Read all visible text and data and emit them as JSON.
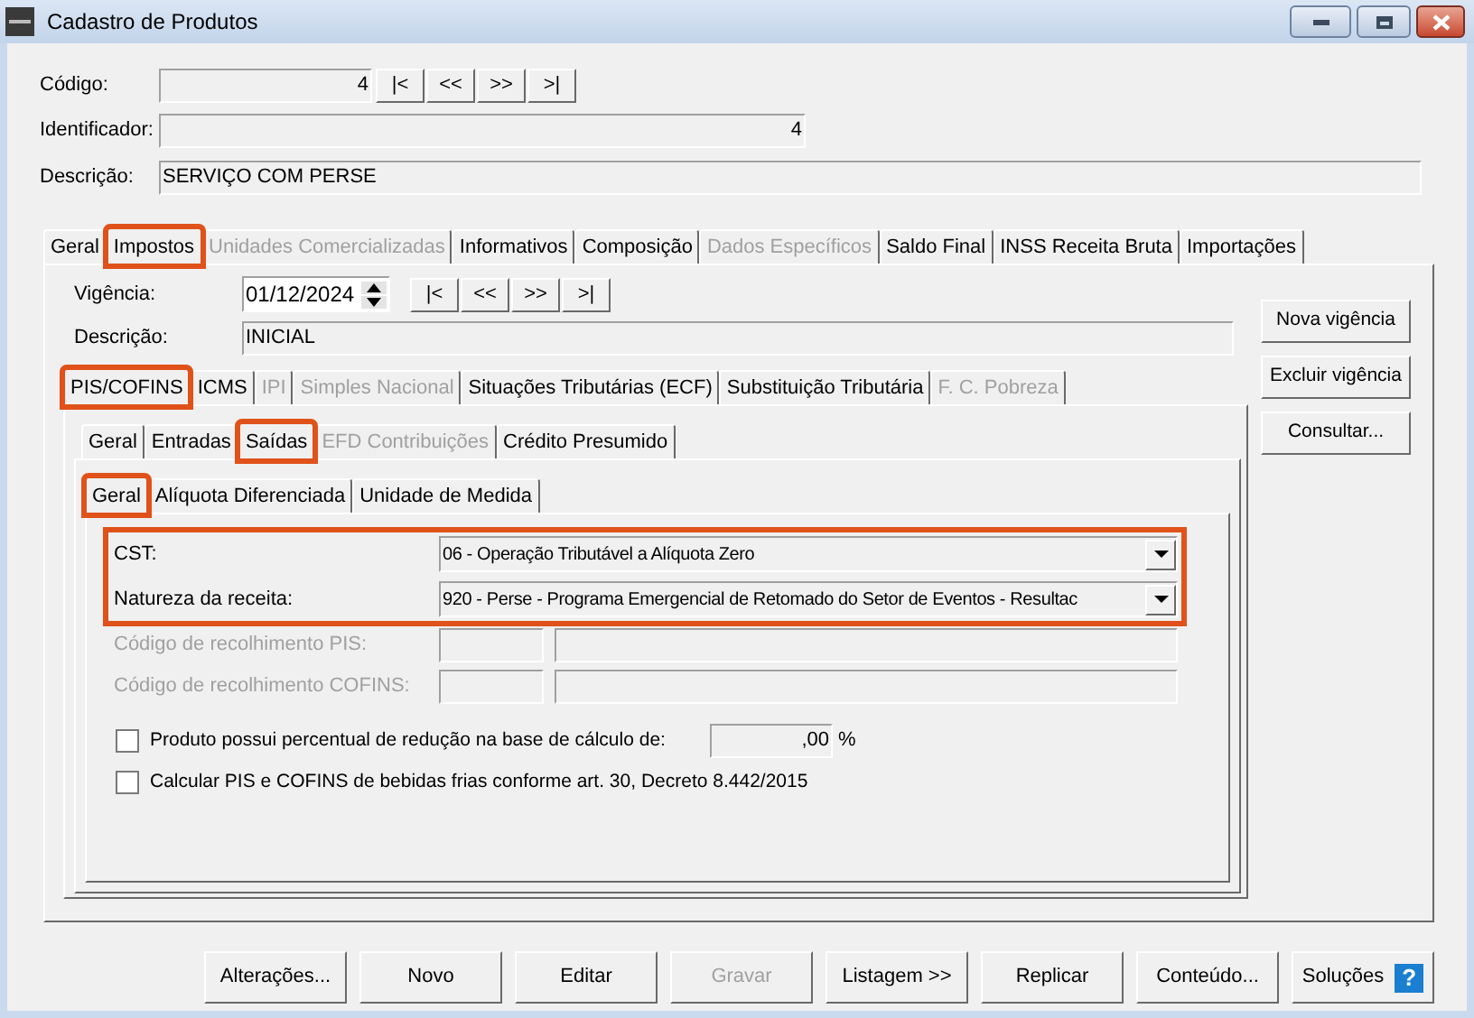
{
  "window": {
    "title": "Cadastro de Produtos"
  },
  "header": {
    "codigo": {
      "label": "Código:",
      "value": "4"
    },
    "nav_buttons": [
      "|<",
      "<<",
      ">>",
      ">|"
    ],
    "identificador": {
      "label": "Identificador:",
      "value": "4"
    },
    "descricao": {
      "label": "Descrição:",
      "value": "SERVIÇO COM PERSE"
    }
  },
  "main_tabs": [
    {
      "label": "Geral",
      "selected": false,
      "disabled": false,
      "highlighted": false
    },
    {
      "label": "Impostos",
      "selected": true,
      "disabled": false,
      "highlighted": true
    },
    {
      "label": "Unidades Comercializadas",
      "selected": false,
      "disabled": true,
      "highlighted": false
    },
    {
      "label": "Informativos",
      "selected": false,
      "disabled": false,
      "highlighted": false
    },
    {
      "label": "Composição",
      "selected": false,
      "disabled": false,
      "highlighted": false
    },
    {
      "label": "Dados Específicos",
      "selected": false,
      "disabled": true,
      "highlighted": false
    },
    {
      "label": "Saldo Final",
      "selected": false,
      "disabled": false,
      "highlighted": false
    },
    {
      "label": "INSS Receita Bruta",
      "selected": false,
      "disabled": false,
      "highlighted": false
    },
    {
      "label": "Importações",
      "selected": false,
      "disabled": false,
      "highlighted": false
    }
  ],
  "vigencia": {
    "label": "Vigência:",
    "value": "01/12/2024",
    "nav_buttons": [
      "|<",
      "<<",
      ">>",
      ">|"
    ]
  },
  "vigencia_descricao": {
    "label": "Descrição:",
    "value": "INICIAL"
  },
  "side_buttons": [
    "Nova vigência",
    "Excluir vigência",
    "Consultar..."
  ],
  "tax_tabs": [
    {
      "label": "PIS/COFINS",
      "selected": true,
      "disabled": false,
      "highlighted": true
    },
    {
      "label": "ICMS",
      "selected": false,
      "disabled": false,
      "highlighted": false
    },
    {
      "label": "IPI",
      "selected": false,
      "disabled": true,
      "highlighted": false
    },
    {
      "label": "Simples Nacional",
      "selected": false,
      "disabled": true,
      "highlighted": false
    },
    {
      "label": "Situações Tributárias (ECF)",
      "selected": false,
      "disabled": false,
      "highlighted": false
    },
    {
      "label": "Substituição Tributária",
      "selected": false,
      "disabled": false,
      "highlighted": false
    },
    {
      "label": "F. C. Pobreza",
      "selected": false,
      "disabled": true,
      "highlighted": false
    }
  ],
  "pis_tabs": [
    {
      "label": "Geral",
      "selected": false,
      "disabled": false,
      "highlighted": false
    },
    {
      "label": "Entradas",
      "selected": false,
      "disabled": false,
      "highlighted": false
    },
    {
      "label": "Saídas",
      "selected": true,
      "disabled": false,
      "highlighted": true
    },
    {
      "label": "EFD Contribuições",
      "selected": false,
      "disabled": true,
      "highlighted": false
    },
    {
      "label": "Crédito Presumido",
      "selected": false,
      "disabled": false,
      "highlighted": false
    }
  ],
  "saidas_tabs": [
    {
      "label": "Geral",
      "selected": true,
      "disabled": false,
      "highlighted": true
    },
    {
      "label": "Alíquota Diferenciada",
      "selected": false,
      "disabled": false,
      "highlighted": false
    },
    {
      "label": "Unidade de Medida",
      "selected": false,
      "disabled": false,
      "highlighted": false
    }
  ],
  "highlighted_group": {
    "highlighted": true,
    "fields": [
      {
        "label": "CST:",
        "value": "06 - Operação Tributável a Alíquota Zero"
      },
      {
        "label": "Natureza da receita:",
        "value": "920 - Perse - Programa Emergencial de Retomado do Setor de Eventos - Resultac"
      }
    ]
  },
  "recolhimento": [
    {
      "label": "Código de recolhimento PIS:",
      "disabled": true
    },
    {
      "label": "Código de recolhimento COFINS:",
      "disabled": true
    }
  ],
  "checkboxes": [
    {
      "label": "Produto possui percentual de redução na base de cálculo de:",
      "checked": false,
      "value": ",00",
      "unit": "%"
    },
    {
      "label": "Calcular PIS e COFINS de bebidas frias conforme art. 30, Decreto 8.442/2015",
      "checked": false
    }
  ],
  "bottom_buttons": [
    {
      "label": "Alterações...",
      "disabled": false
    },
    {
      "label": "Novo",
      "disabled": false
    },
    {
      "label": "Editar",
      "disabled": false
    },
    {
      "label": "Gravar",
      "disabled": true
    },
    {
      "label": "Listagem >>",
      "disabled": false
    },
    {
      "label": "Replicar",
      "disabled": false
    },
    {
      "label": "Conteúdo...",
      "disabled": false
    },
    {
      "label": "Soluções",
      "disabled": false,
      "help": "?"
    }
  ]
}
